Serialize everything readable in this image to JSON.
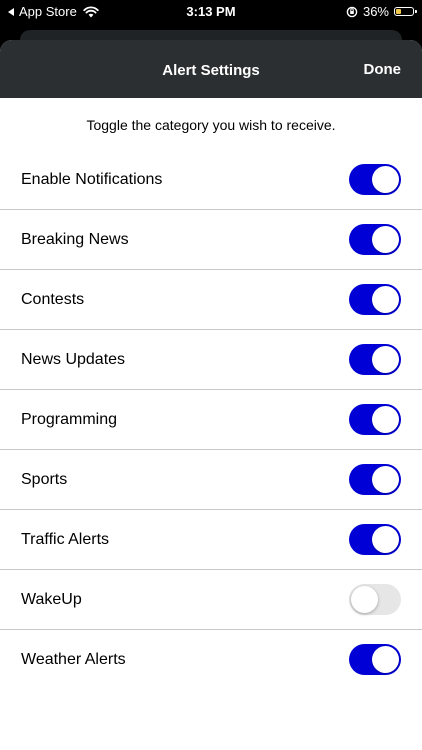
{
  "status_bar": {
    "back_app": "App Store",
    "time": "3:13 PM",
    "battery": "36%",
    "battery_level": 0.36
  },
  "nav": {
    "title": "Alert Settings",
    "done_label": "Done"
  },
  "instructions": "Toggle the category you wish to receive.",
  "toggles": [
    {
      "label": "Enable Notifications",
      "on": true
    },
    {
      "label": "Breaking News",
      "on": true
    },
    {
      "label": "Contests",
      "on": true
    },
    {
      "label": "News Updates",
      "on": true
    },
    {
      "label": "Programming",
      "on": true
    },
    {
      "label": "Sports",
      "on": true
    },
    {
      "label": "Traffic Alerts",
      "on": true
    },
    {
      "label": "WakeUp",
      "on": false
    },
    {
      "label": "Weather Alerts",
      "on": true
    }
  ],
  "colors": {
    "toggle_on": "#0000d6",
    "toggle_off": "#e6e6e6",
    "nav_bg": "#2b2f31"
  }
}
